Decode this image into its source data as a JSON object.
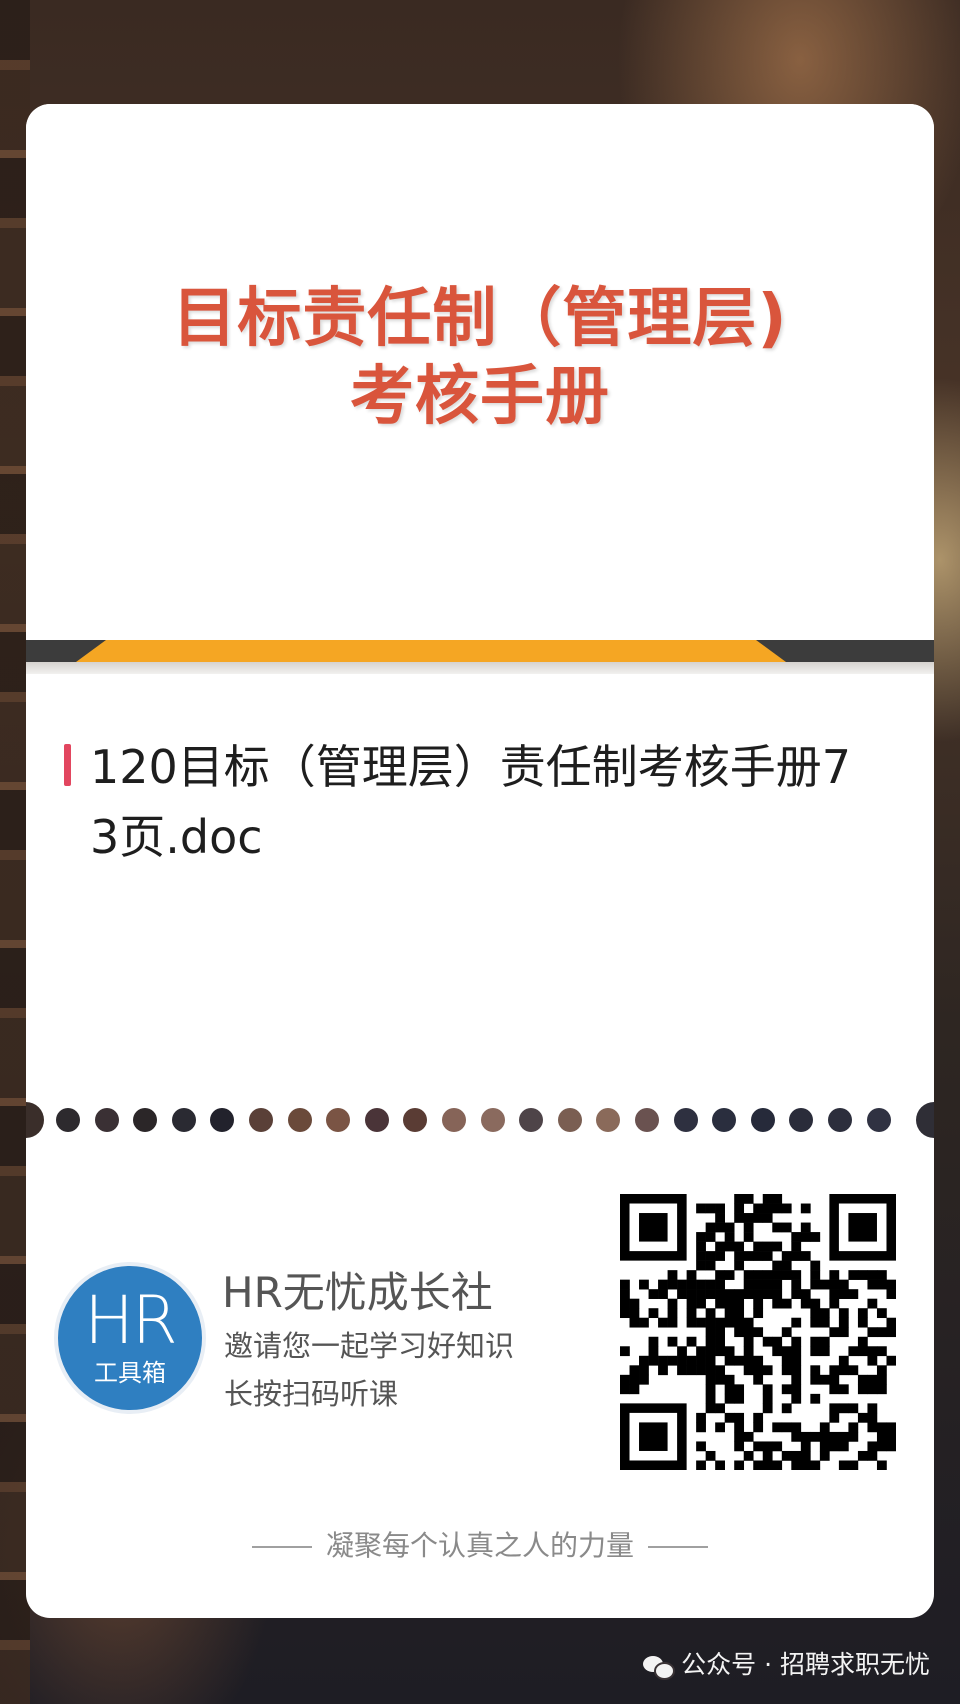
{
  "cover": {
    "title_line1": "目标责任制（管理层)",
    "title_line2": "考核手册"
  },
  "document": {
    "title": "120目标（管理层）责任制考核手册73页.doc"
  },
  "brand": {
    "logo_main": "HR",
    "logo_sub": "工具箱",
    "name": "HR无忧成长社",
    "line1": "邀请您一起学习好知识",
    "line2": "长按扫码听课"
  },
  "slogan": "凝聚每个认真之人的力量",
  "source": {
    "icon": "wechat-icon",
    "label": "公众号 · 招聘求职无忧"
  },
  "colors": {
    "cover_title": "#d9553c",
    "accent_bar": "#e2465f",
    "stripe_orange": "#f5a623",
    "logo_blue": "#2f7fc1"
  }
}
